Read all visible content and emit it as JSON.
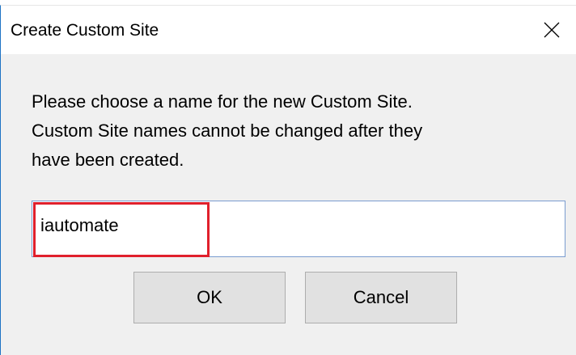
{
  "dialog": {
    "title": "Create Custom Site",
    "close_icon": "close-icon",
    "message_lines": [
      "Please choose a name for the new Custom Site.",
      "Custom Site names cannot be changed after they",
      "have been created."
    ],
    "name_input": {
      "value": "iautomate",
      "placeholder": ""
    },
    "ok_label": "OK",
    "cancel_label": "Cancel",
    "colors": {
      "highlight": "#e0202c",
      "window_border": "#1e73c4",
      "input_border": "#7a9ccf",
      "button_face": "#e1e1e1",
      "dialog_background": "#f0f0f0"
    }
  }
}
